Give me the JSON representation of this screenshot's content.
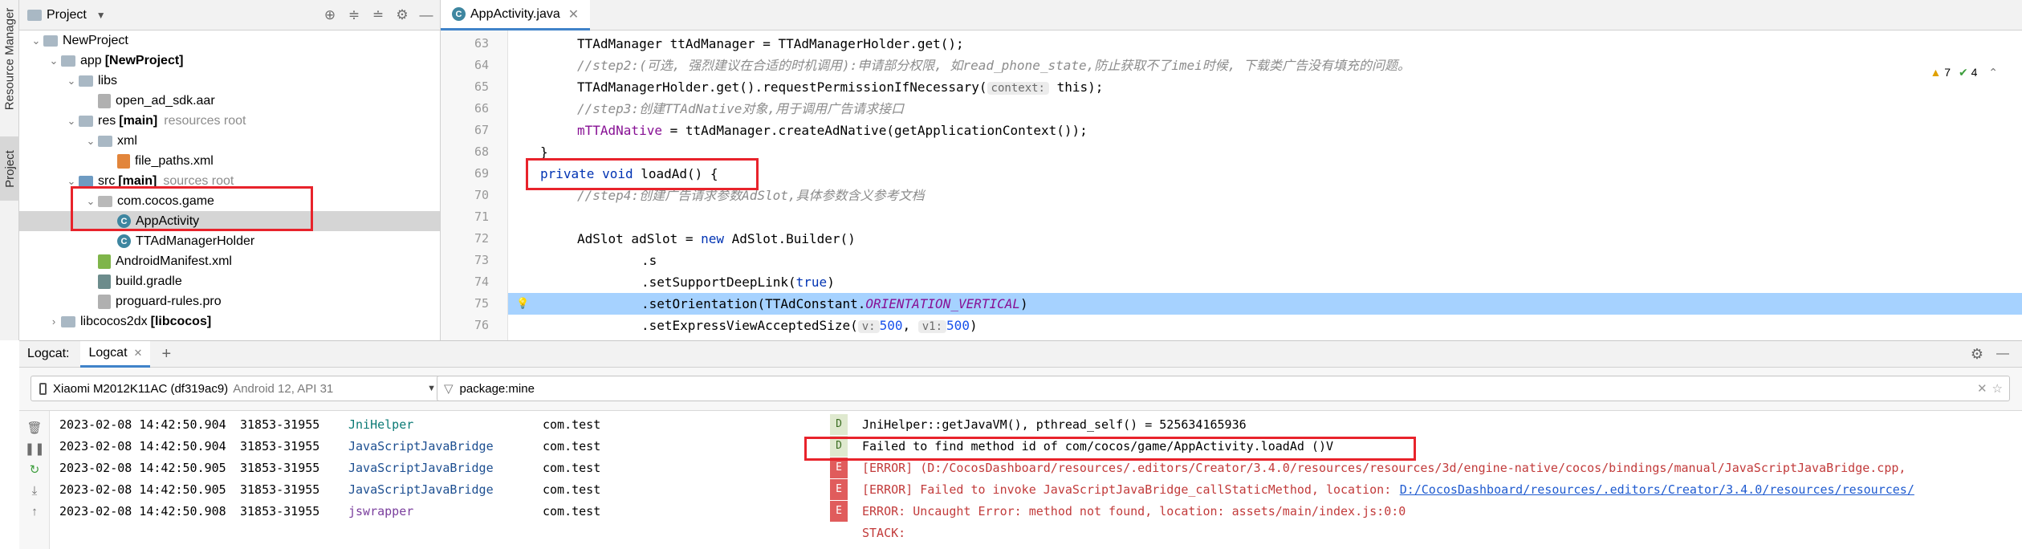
{
  "side_tabs": {
    "resource_manager": "Resource Manager",
    "project": "Project"
  },
  "project_panel": {
    "title": "Project",
    "tree": [
      {
        "label": "NewProject",
        "level": 0
      },
      {
        "label": "app",
        "bold": "[NewProject]",
        "level": 1
      },
      {
        "label": "libs",
        "level": 2
      },
      {
        "label": "open_ad_sdk.aar",
        "level": 3
      },
      {
        "label": "res",
        "bold": "[main]",
        "note": "resources root",
        "level": 2
      },
      {
        "label": "xml",
        "level": 3
      },
      {
        "label": "file_paths.xml",
        "level": 4
      },
      {
        "label": "src",
        "bold": "[main]",
        "note": "sources root",
        "level": 2
      },
      {
        "label": "com.cocos.game",
        "level": 3
      },
      {
        "label": "AppActivity",
        "level": 4
      },
      {
        "label": "TTAdManagerHolder",
        "level": 4
      },
      {
        "label": "AndroidManifest.xml",
        "level": 3
      },
      {
        "label": "build.gradle",
        "level": 3
      },
      {
        "label": "proguard-rules.pro",
        "level": 3
      },
      {
        "label": "libcocos2dx",
        "bold": "[libcocos]",
        "level": 1
      }
    ]
  },
  "editor": {
    "tab": "AppActivity.java",
    "inspections": {
      "warnings": "7",
      "ok": "4"
    },
    "lines": [
      {
        "n": "63",
        "code": "TTAdManager ttAdManager = TTAdManagerHolder.get();"
      },
      {
        "n": "64",
        "code": "//step2:(可选, 强烈建议在合适的时机调用):申请部分权限, 如read_phone_state,防止获取不了imei时候, 下载类广告没有填充的问题。"
      },
      {
        "n": "65",
        "code_a": "TTAdManagerHolder.get().requestPermissionIfNecessary(",
        "hint": "context:",
        "code_b": " this);"
      },
      {
        "n": "66",
        "code": "//step3:创建TTAdNative对象,用于调用广告请求接口"
      },
      {
        "n": "67",
        "code_a": "mTTAdNative",
        "code_b": " = ttAdManager.createAdNative(getApplicationContext());"
      },
      {
        "n": "68",
        "code": "}"
      },
      {
        "n": "69",
        "kw": "private void ",
        "code": "loadAd() {"
      },
      {
        "n": "70",
        "code": "//step4:创建广告请求参数AdSlot,具体参数含义参考文档"
      },
      {
        "n": "71",
        "code": ""
      },
      {
        "n": "72",
        "code_a": "AdSlot adSlot = ",
        "kw": "new",
        "code_b": " AdSlot.Builder()"
      },
      {
        "n": "73",
        "code": ".s"
      },
      {
        "n": "74",
        "code_a": ".setSupportDeepLink(",
        "kw": "true",
        "code_b": ")"
      },
      {
        "n": "75",
        "code_a": ".setOrientation(TTAdConstant.",
        "cst": "ORIENTATION_VERTICAL",
        "code_b": ")"
      },
      {
        "n": "76",
        "code_a": ".setExpressViewAcceptedSize(",
        "hint1": "v:",
        "num1": "500",
        "sep": ", ",
        "hint2": "v1:",
        "num2": "500",
        "code_b": ")"
      }
    ]
  },
  "logcat": {
    "label": "Logcat:",
    "tab": "Logcat",
    "device": "Xiaomi M2012K11AC (df319ac9)",
    "device_api": "Android 12, API 31",
    "filter": "package:mine",
    "rows": [
      {
        "time": "2023-02-08 14:42:50.904",
        "pid": "31853-31955",
        "tag": "JniHelper",
        "pkg": "com.test",
        "level": "D",
        "msg": "JniHelper::getJavaVM(), pthread_self() = 525634165936"
      },
      {
        "time": "2023-02-08 14:42:50.904",
        "pid": "31853-31955",
        "tag": "JavaScriptJavaBridge",
        "pkg": "com.test",
        "level": "D",
        "msg": "Failed to find method id of com/cocos/game/AppActivity.loadAd ()V"
      },
      {
        "time": "2023-02-08 14:42:50.905",
        "pid": "31853-31955",
        "tag": "JavaScriptJavaBridge",
        "pkg": "com.test",
        "level": "E",
        "msg": "[ERROR] (D:/CocosDashboard/resources/.editors/Creator/3.4.0/resources/resources/3d/engine-native/cocos/bindings/manual/JavaScriptJavaBridge.cpp,"
      },
      {
        "time": "2023-02-08 14:42:50.905",
        "pid": "31853-31955",
        "tag": "JavaScriptJavaBridge",
        "pkg": "com.test",
        "level": "E",
        "msg": "[ERROR] Failed to invoke JavaScriptJavaBridge_callStaticMethod, location: ",
        "link": "D:/CocosDashboard/resources/.editors/Creator/3.4.0/resources/resources/"
      },
      {
        "time": "2023-02-08 14:42:50.908",
        "pid": "31853-31955",
        "tag": "jswrapper",
        "pkg": "com.test",
        "level": "E",
        "msg": "ERROR: Uncaught Error: method not found, location: assets/main/index.js:0:0"
      },
      {
        "time": "",
        "pid": "",
        "tag": "",
        "pkg": "",
        "level": "",
        "msg": "STACK:"
      }
    ]
  },
  "colors": {
    "accent": "#4083c9",
    "highlight_line": "#a6d2ff",
    "annotation_box": "#e8232b",
    "error_level": "#e05c5c"
  }
}
